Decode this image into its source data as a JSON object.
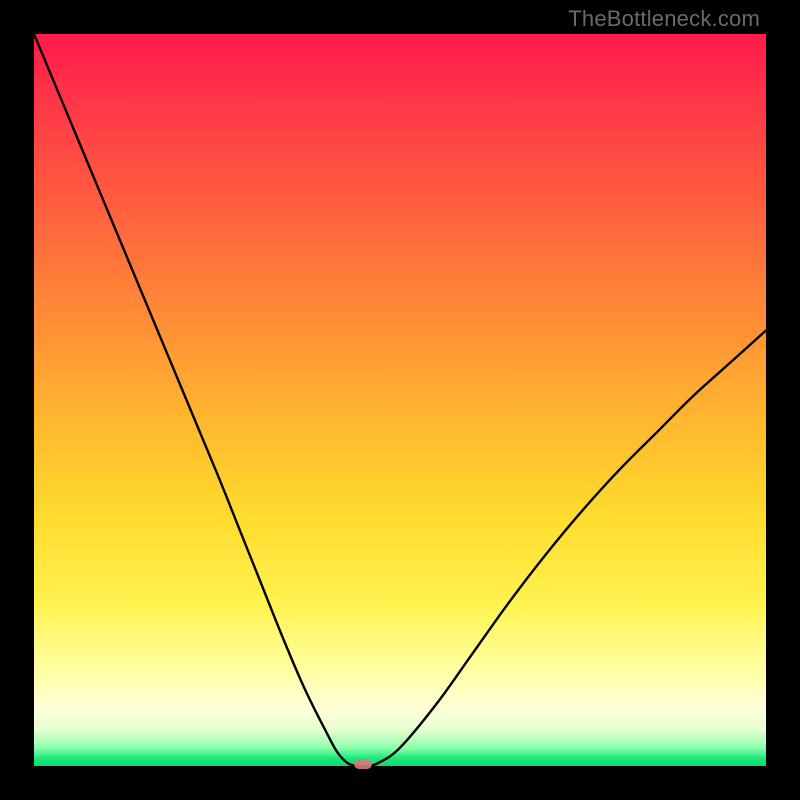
{
  "watermark": "TheBottleneck.com",
  "chart_data": {
    "type": "line",
    "x": [
      0.0,
      0.05,
      0.1,
      0.15,
      0.2,
      0.25,
      0.28,
      0.31,
      0.34,
      0.37,
      0.4,
      0.415,
      0.43,
      0.445,
      0.455,
      0.47,
      0.5,
      0.55,
      0.6,
      0.65,
      0.7,
      0.75,
      0.8,
      0.85,
      0.9,
      0.95,
      1.0
    ],
    "values": [
      1.0,
      0.88,
      0.76,
      0.64,
      0.52,
      0.4,
      0.325,
      0.25,
      0.175,
      0.105,
      0.045,
      0.018,
      0.003,
      0.0,
      0.0,
      0.004,
      0.025,
      0.085,
      0.155,
      0.225,
      0.29,
      0.35,
      0.405,
      0.455,
      0.505,
      0.55,
      0.595
    ],
    "title": "",
    "xlabel": "",
    "ylabel": "",
    "xlim": [
      0,
      1
    ],
    "ylim": [
      0,
      1
    ],
    "marker": {
      "x": 0.45,
      "y": 0.0
    }
  },
  "colors": {
    "curve": "#000000",
    "marker": "#d87a78"
  }
}
